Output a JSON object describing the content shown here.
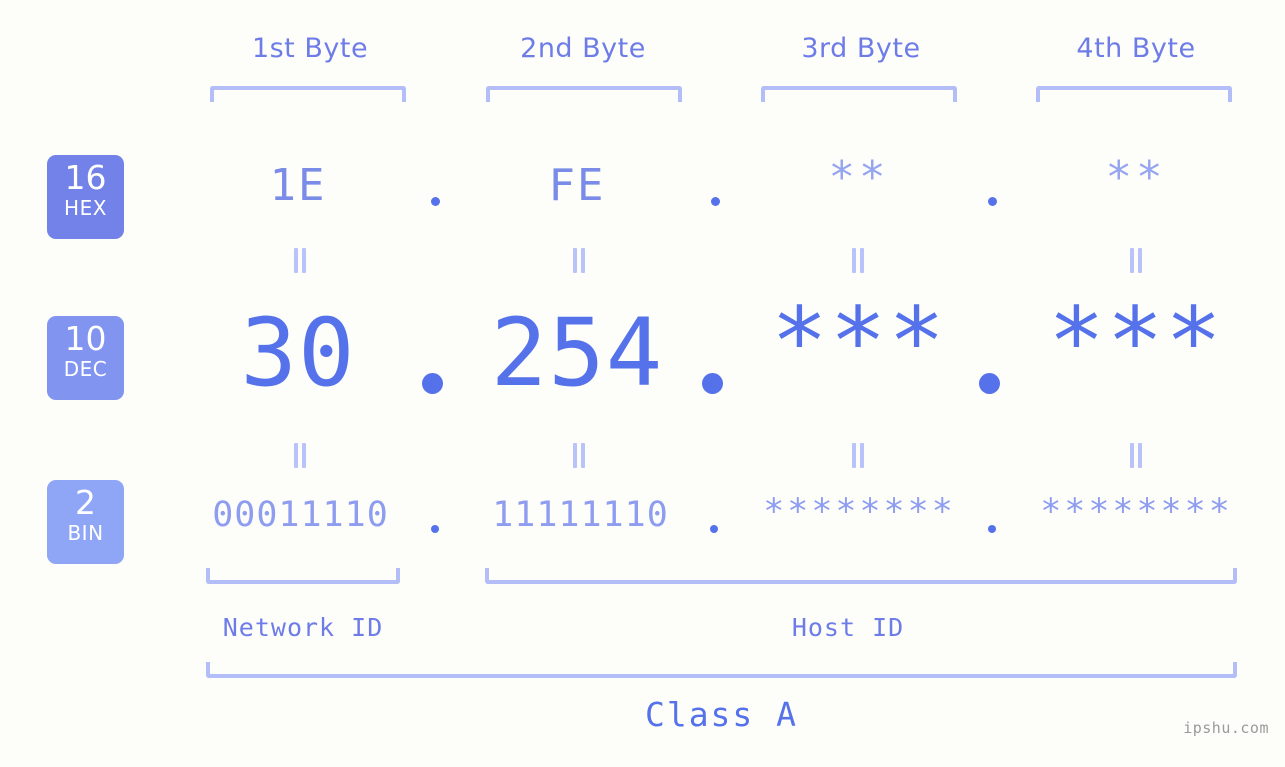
{
  "background_color": "#fdfefa",
  "accent_color": "#5572eb",
  "colors": {
    "label_blue": "#6e7ce8",
    "bracket_blue": "#b3bdf8",
    "hex_text": "#7b8ce8",
    "hex_star": "#96a5ef",
    "dec_text": "#5572eb",
    "bin_text": "#8e9df0",
    "badge_hex": "#7282e8",
    "badge_dec": "#8094f0",
    "badge_bin": "#8ea6f5",
    "watermark": "#9a9a9a"
  },
  "byte_headers": [
    {
      "label": "1st Byte"
    },
    {
      "label": "2nd Byte"
    },
    {
      "label": "3rd Byte"
    },
    {
      "label": "4th Byte"
    }
  ],
  "badges": [
    {
      "number": "16",
      "name": "HEX"
    },
    {
      "number": "10",
      "name": "DEC"
    },
    {
      "number": "2",
      "name": "BIN"
    }
  ],
  "rows": {
    "hex": {
      "base_number": "16",
      "base_name": "HEX",
      "values": [
        "1E",
        "FE",
        "**",
        "**"
      ],
      "separator": "."
    },
    "dec": {
      "base_number": "10",
      "base_name": "DEC",
      "values": [
        "30",
        "254",
        "***",
        "***"
      ],
      "separator": "."
    },
    "bin": {
      "base_number": "2",
      "base_name": "BIN",
      "values": [
        "00011110",
        "11111110",
        "********",
        "********"
      ],
      "separator": "."
    }
  },
  "connectors": {
    "symbol": "=",
    "count_per_gap": 4,
    "gaps": 2
  },
  "id_sections": [
    {
      "label": "Network ID"
    },
    {
      "label": "Host ID"
    }
  ],
  "class_label": "Class A",
  "watermark": "ipshu.com"
}
